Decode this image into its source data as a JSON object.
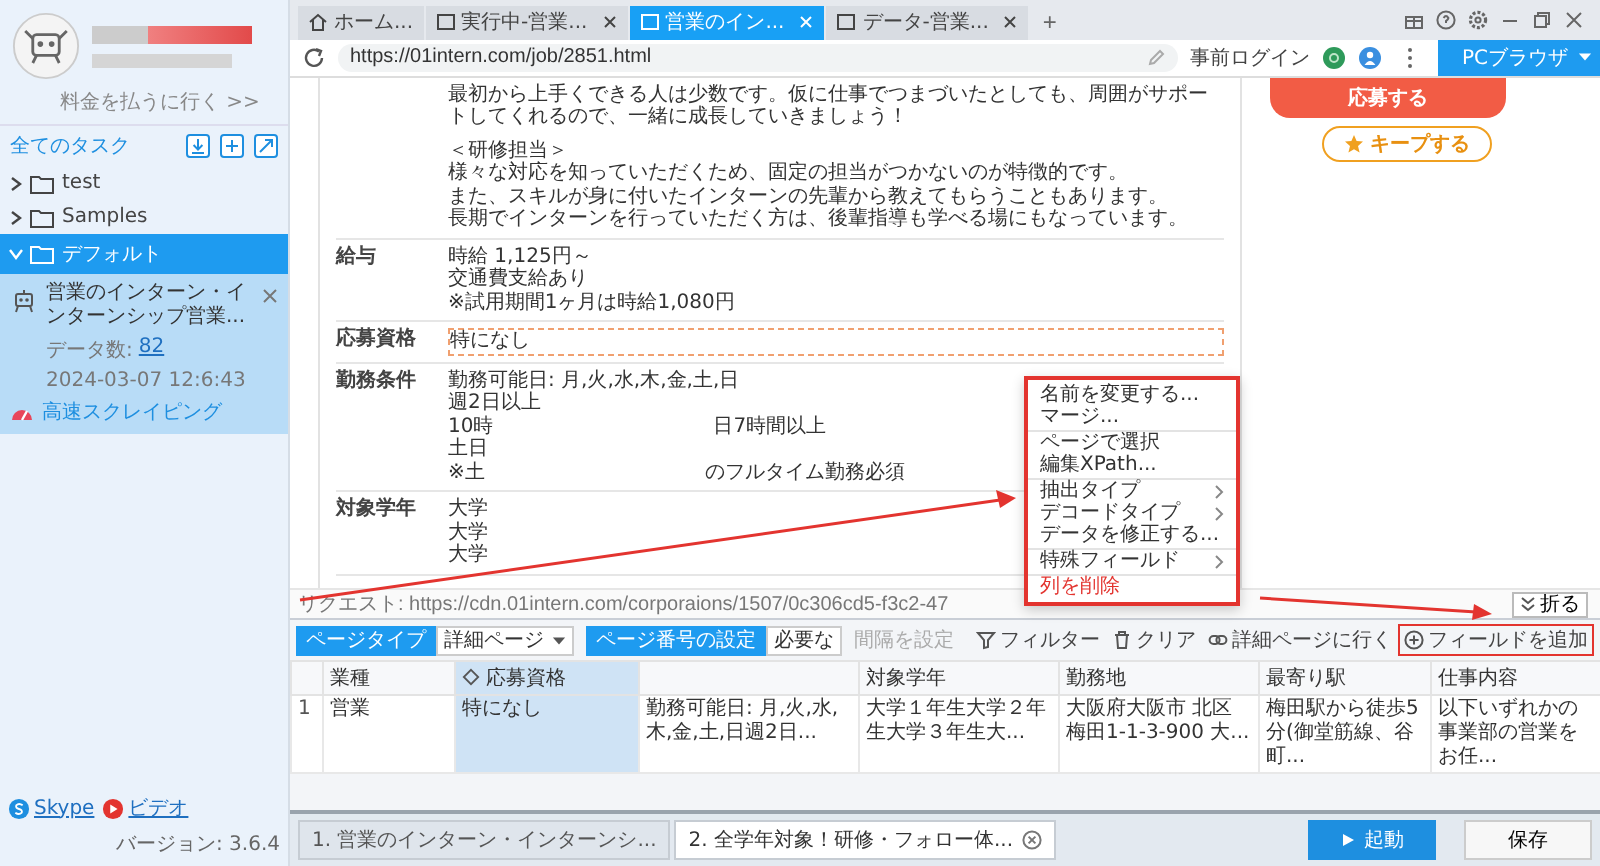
{
  "sidebar": {
    "pay_link": "料金を払うに行く >>",
    "section_title": "全てのタスク",
    "folders": [
      {
        "name": "test",
        "expanded": false,
        "selected": false
      },
      {
        "name": "Samples",
        "expanded": false,
        "selected": false
      },
      {
        "name": "デフォルト",
        "expanded": true,
        "selected": true,
        "tasks": [
          {
            "title": "営業のインターン・インターンシップ営業...",
            "data_label": "データ数:",
            "data_count": "82",
            "date": "2024-03-07 12:6:43",
            "mode": "高速スクレイピング"
          }
        ]
      }
    ],
    "footer_links": [
      {
        "label": "Skype",
        "kind": "skype"
      },
      {
        "label": "ビデオ",
        "kind": "video"
      }
    ],
    "version": "バージョン: 3.6.4"
  },
  "browser_tabs": [
    {
      "label": "ホーム...",
      "kind": "home",
      "selected": false
    },
    {
      "label": "実行中-営業...",
      "kind": "page",
      "selected": false
    },
    {
      "label": "営業のイン...",
      "kind": "page",
      "selected": true
    },
    {
      "label": "データ-営業...",
      "kind": "page",
      "selected": false
    }
  ],
  "new_tab": "+",
  "address_bar": {
    "url": "https://01intern.com/job/2851.html",
    "login": "事前ログイン",
    "browser_button": "PCブラウザ"
  },
  "page": {
    "intro": [
      "最初から上手くできる人は少数です。仮に仕事でつまづいたとしても、周囲がサポートしてくれるので、一緒に成長していきましょう！",
      "＜研修担当＞",
      "様々な対応を知っていただくため、固定の担当がつかないのが特徴的です。",
      "また、スキルが身に付いたインターンの先輩から教えてもらうこともあります。",
      "長期でインターンを行っていただく方は、後輩指導も学べる場にもなっています。"
    ],
    "sections": [
      {
        "label": "給与",
        "highlighted": false,
        "lines": [
          [
            "時給 1,125円～"
          ],
          [
            "交通費支給あり"
          ],
          [
            "※試用期間1ヶ月は時給1,080円"
          ]
        ]
      },
      {
        "label": "応募資格",
        "highlighted": true,
        "lines": [
          [
            "特になし"
          ]
        ]
      },
      {
        "label": "勤務条件",
        "highlighted": false,
        "lines": [
          [
            "勤務可能日: 月,火,水,木,金,土,日"
          ],
          [
            "週2日以上"
          ],
          [
            "10時",
            "日7時間以上"
          ],
          [
            "土日"
          ],
          [
            "※土",
            "のフルタイム勤務必須"
          ]
        ]
      },
      {
        "label": "対象学年",
        "highlighted": false,
        "lines": [
          [
            "大学"
          ],
          [
            "大学"
          ],
          [
            "大学"
          ]
        ]
      }
    ],
    "apply_button": "応募する",
    "keep_button": "キープする"
  },
  "request_bar": {
    "text": "リクエスト: https://cdn.01intern.com/corporaions/1507/0c306cd5-f3c2-47",
    "collapse": "折る"
  },
  "context_menu": [
    {
      "label": "名前を変更する...",
      "kind": "action",
      "separator_above": false
    },
    {
      "label": "マージ...",
      "kind": "action",
      "separator_above": false
    },
    {
      "label": "ページで選択",
      "kind": "action",
      "separator_above": true
    },
    {
      "label": "編集XPath...",
      "kind": "action",
      "separator_above": false
    },
    {
      "label": "抽出タイプ",
      "kind": "submenu",
      "separator_above": true
    },
    {
      "label": "デコードタイプ",
      "kind": "submenu",
      "separator_above": false
    },
    {
      "label": "データを修正する...",
      "kind": "action",
      "separator_above": false
    },
    {
      "label": "特殊フィールド",
      "kind": "submenu",
      "separator_above": true
    },
    {
      "label": "列を削除",
      "kind": "danger",
      "separator_above": true
    }
  ],
  "toolbar": {
    "page_type_label": "ページタイプ",
    "page_type_value": "詳細ページ",
    "page_number_label": "ページ番号の設定",
    "page_number_value": "必要な",
    "interval": "間隔を設定",
    "actions": [
      {
        "label": "フィルター",
        "kind": "filter",
        "annotated": false
      },
      {
        "label": "クリア",
        "kind": "clear",
        "annotated": false
      },
      {
        "label": "詳細ページに行く",
        "kind": "link",
        "annotated": false
      },
      {
        "label": "フィールドを追加",
        "kind": "add",
        "annotated": true
      }
    ]
  },
  "table": {
    "columns": [
      {
        "label": "業種",
        "selected": false
      },
      {
        "label": "応募資格",
        "selected": true
      },
      {
        "selected": false
      },
      {
        "label": "対象学年",
        "selected": false
      },
      {
        "label": "勤務地",
        "selected": false
      },
      {
        "label": "最寄り駅",
        "selected": false
      },
      {
        "label": "仕事内容",
        "selected": false
      }
    ],
    "rows": [
      {
        "index": "1",
        "cells": [
          "営業",
          "特になし",
          "勤務可能日: 月,火,水,木,金,土,日週2日...",
          "大学１年生大学２年生大学３年生大...",
          "大阪府大阪市 北区梅田1-1-3-900 大...",
          "梅田駅から徒歩5分(御堂筋線、谷町...",
          "以下いずれかの事業部の営業をお任..."
        ]
      }
    ]
  },
  "task_tabs": [
    {
      "label": "1. 営業のインターン・インターンシ...",
      "selected": false
    },
    {
      "label": "2. 全学年対象！研修・フォロー体...",
      "selected": true
    }
  ],
  "run_button": "起動",
  "save_button": "保存"
}
